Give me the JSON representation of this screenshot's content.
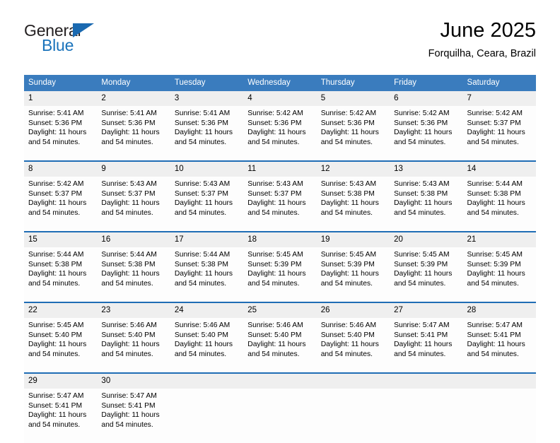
{
  "brand": {
    "name_part1": "General",
    "name_part2": "Blue",
    "triangle_icon": "triangle-logo-icon",
    "color_dark": "#231f20",
    "color_blue": "#1a73bb"
  },
  "header": {
    "title": "June 2025",
    "subtitle": "Forquilha, Ceara, Brazil"
  },
  "theme": {
    "header_blue": "#3a7cbe",
    "separator_blue": "#1f6db5",
    "daynum_band": "#efefef",
    "cell_background": "#fdfdfd"
  },
  "calendar": {
    "weekday_headers": [
      "Sunday",
      "Monday",
      "Tuesday",
      "Wednesday",
      "Thursday",
      "Friday",
      "Saturday"
    ],
    "weeks": [
      {
        "days": [
          {
            "date": "1",
            "sunrise": "Sunrise: 5:41 AM",
            "sunset": "Sunset: 5:36 PM",
            "daylight": "Daylight: 11 hours and 54 minutes."
          },
          {
            "date": "2",
            "sunrise": "Sunrise: 5:41 AM",
            "sunset": "Sunset: 5:36 PM",
            "daylight": "Daylight: 11 hours and 54 minutes."
          },
          {
            "date": "3",
            "sunrise": "Sunrise: 5:41 AM",
            "sunset": "Sunset: 5:36 PM",
            "daylight": "Daylight: 11 hours and 54 minutes."
          },
          {
            "date": "4",
            "sunrise": "Sunrise: 5:42 AM",
            "sunset": "Sunset: 5:36 PM",
            "daylight": "Daylight: 11 hours and 54 minutes."
          },
          {
            "date": "5",
            "sunrise": "Sunrise: 5:42 AM",
            "sunset": "Sunset: 5:36 PM",
            "daylight": "Daylight: 11 hours and 54 minutes."
          },
          {
            "date": "6",
            "sunrise": "Sunrise: 5:42 AM",
            "sunset": "Sunset: 5:36 PM",
            "daylight": "Daylight: 11 hours and 54 minutes."
          },
          {
            "date": "7",
            "sunrise": "Sunrise: 5:42 AM",
            "sunset": "Sunset: 5:37 PM",
            "daylight": "Daylight: 11 hours and 54 minutes."
          }
        ]
      },
      {
        "days": [
          {
            "date": "8",
            "sunrise": "Sunrise: 5:42 AM",
            "sunset": "Sunset: 5:37 PM",
            "daylight": "Daylight: 11 hours and 54 minutes."
          },
          {
            "date": "9",
            "sunrise": "Sunrise: 5:43 AM",
            "sunset": "Sunset: 5:37 PM",
            "daylight": "Daylight: 11 hours and 54 minutes."
          },
          {
            "date": "10",
            "sunrise": "Sunrise: 5:43 AM",
            "sunset": "Sunset: 5:37 PM",
            "daylight": "Daylight: 11 hours and 54 minutes."
          },
          {
            "date": "11",
            "sunrise": "Sunrise: 5:43 AM",
            "sunset": "Sunset: 5:37 PM",
            "daylight": "Daylight: 11 hours and 54 minutes."
          },
          {
            "date": "12",
            "sunrise": "Sunrise: 5:43 AM",
            "sunset": "Sunset: 5:38 PM",
            "daylight": "Daylight: 11 hours and 54 minutes."
          },
          {
            "date": "13",
            "sunrise": "Sunrise: 5:43 AM",
            "sunset": "Sunset: 5:38 PM",
            "daylight": "Daylight: 11 hours and 54 minutes."
          },
          {
            "date": "14",
            "sunrise": "Sunrise: 5:44 AM",
            "sunset": "Sunset: 5:38 PM",
            "daylight": "Daylight: 11 hours and 54 minutes."
          }
        ]
      },
      {
        "days": [
          {
            "date": "15",
            "sunrise": "Sunrise: 5:44 AM",
            "sunset": "Sunset: 5:38 PM",
            "daylight": "Daylight: 11 hours and 54 minutes."
          },
          {
            "date": "16",
            "sunrise": "Sunrise: 5:44 AM",
            "sunset": "Sunset: 5:38 PM",
            "daylight": "Daylight: 11 hours and 54 minutes."
          },
          {
            "date": "17",
            "sunrise": "Sunrise: 5:44 AM",
            "sunset": "Sunset: 5:38 PM",
            "daylight": "Daylight: 11 hours and 54 minutes."
          },
          {
            "date": "18",
            "sunrise": "Sunrise: 5:45 AM",
            "sunset": "Sunset: 5:39 PM",
            "daylight": "Daylight: 11 hours and 54 minutes."
          },
          {
            "date": "19",
            "sunrise": "Sunrise: 5:45 AM",
            "sunset": "Sunset: 5:39 PM",
            "daylight": "Daylight: 11 hours and 54 minutes."
          },
          {
            "date": "20",
            "sunrise": "Sunrise: 5:45 AM",
            "sunset": "Sunset: 5:39 PM",
            "daylight": "Daylight: 11 hours and 54 minutes."
          },
          {
            "date": "21",
            "sunrise": "Sunrise: 5:45 AM",
            "sunset": "Sunset: 5:39 PM",
            "daylight": "Daylight: 11 hours and 54 minutes."
          }
        ]
      },
      {
        "days": [
          {
            "date": "22",
            "sunrise": "Sunrise: 5:45 AM",
            "sunset": "Sunset: 5:40 PM",
            "daylight": "Daylight: 11 hours and 54 minutes."
          },
          {
            "date": "23",
            "sunrise": "Sunrise: 5:46 AM",
            "sunset": "Sunset: 5:40 PM",
            "daylight": "Daylight: 11 hours and 54 minutes."
          },
          {
            "date": "24",
            "sunrise": "Sunrise: 5:46 AM",
            "sunset": "Sunset: 5:40 PM",
            "daylight": "Daylight: 11 hours and 54 minutes."
          },
          {
            "date": "25",
            "sunrise": "Sunrise: 5:46 AM",
            "sunset": "Sunset: 5:40 PM",
            "daylight": "Daylight: 11 hours and 54 minutes."
          },
          {
            "date": "26",
            "sunrise": "Sunrise: 5:46 AM",
            "sunset": "Sunset: 5:40 PM",
            "daylight": "Daylight: 11 hours and 54 minutes."
          },
          {
            "date": "27",
            "sunrise": "Sunrise: 5:47 AM",
            "sunset": "Sunset: 5:41 PM",
            "daylight": "Daylight: 11 hours and 54 minutes."
          },
          {
            "date": "28",
            "sunrise": "Sunrise: 5:47 AM",
            "sunset": "Sunset: 5:41 PM",
            "daylight": "Daylight: 11 hours and 54 minutes."
          }
        ]
      },
      {
        "days": [
          {
            "date": "29",
            "sunrise": "Sunrise: 5:47 AM",
            "sunset": "Sunset: 5:41 PM",
            "daylight": "Daylight: 11 hours and 54 minutes."
          },
          {
            "date": "30",
            "sunrise": "Sunrise: 5:47 AM",
            "sunset": "Sunset: 5:41 PM",
            "daylight": "Daylight: 11 hours and 54 minutes."
          },
          {
            "date": "",
            "sunrise": "",
            "sunset": "",
            "daylight": ""
          },
          {
            "date": "",
            "sunrise": "",
            "sunset": "",
            "daylight": ""
          },
          {
            "date": "",
            "sunrise": "",
            "sunset": "",
            "daylight": ""
          },
          {
            "date": "",
            "sunrise": "",
            "sunset": "",
            "daylight": ""
          },
          {
            "date": "",
            "sunrise": "",
            "sunset": "",
            "daylight": ""
          }
        ]
      }
    ]
  }
}
